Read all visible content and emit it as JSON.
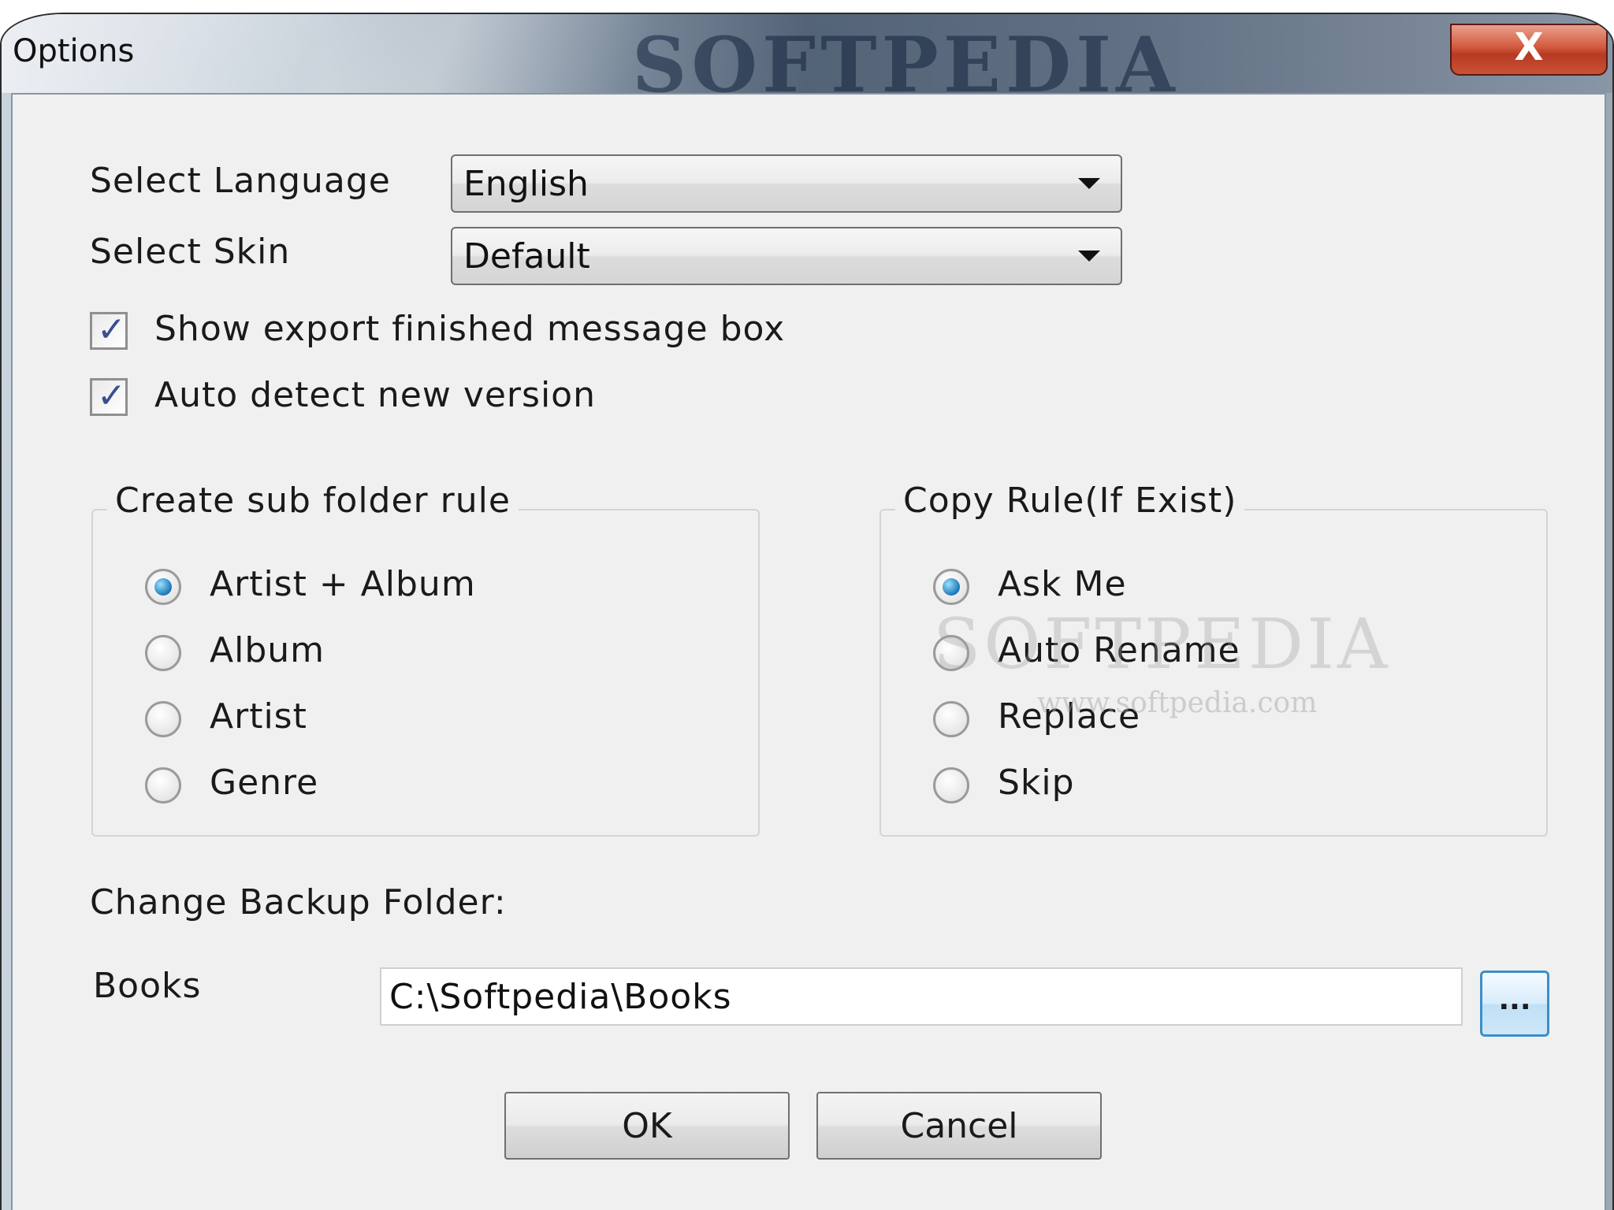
{
  "window": {
    "title": "Options",
    "watermark": "SOFTPEDIA",
    "close_glyph": "X"
  },
  "language": {
    "label": "Select Language",
    "value": "English"
  },
  "skin": {
    "label": "Select Skin",
    "value": "Default"
  },
  "checkboxes": {
    "show_export": {
      "label": "Show export finished message box",
      "checked": true
    },
    "auto_detect": {
      "label": "Auto detect new version",
      "checked": true
    }
  },
  "subfolder_rule": {
    "title": "Create sub folder rule",
    "options": [
      "Artist + Album",
      "Album",
      "Artist",
      "Genre"
    ],
    "selected": "Artist + Album"
  },
  "copy_rule": {
    "title": "Copy Rule(If Exist)",
    "options": [
      "Ask Me",
      "Auto Rename",
      "Replace",
      "Skip"
    ],
    "selected": "Ask Me"
  },
  "backup": {
    "heading": "Change Backup Folder:",
    "field_label": "Books",
    "path": "C:\\Softpedia\\Books",
    "browse_label": "..."
  },
  "buttons": {
    "ok": "OK",
    "cancel": "Cancel"
  },
  "watermark_mid": {
    "text": "SOFTPEDIA",
    "url": "www.softpedia.com"
  },
  "colors": {
    "client_bg": "#f0f0f0",
    "radio_selected": "#1b77b8",
    "checkmark": "#3a4f8f",
    "close_button": "#c8482c"
  },
  "icons": {
    "close": "close-icon",
    "dropdown": "chevron-down-icon",
    "check": "checkmark-icon",
    "radio": "radio-dot-icon"
  }
}
